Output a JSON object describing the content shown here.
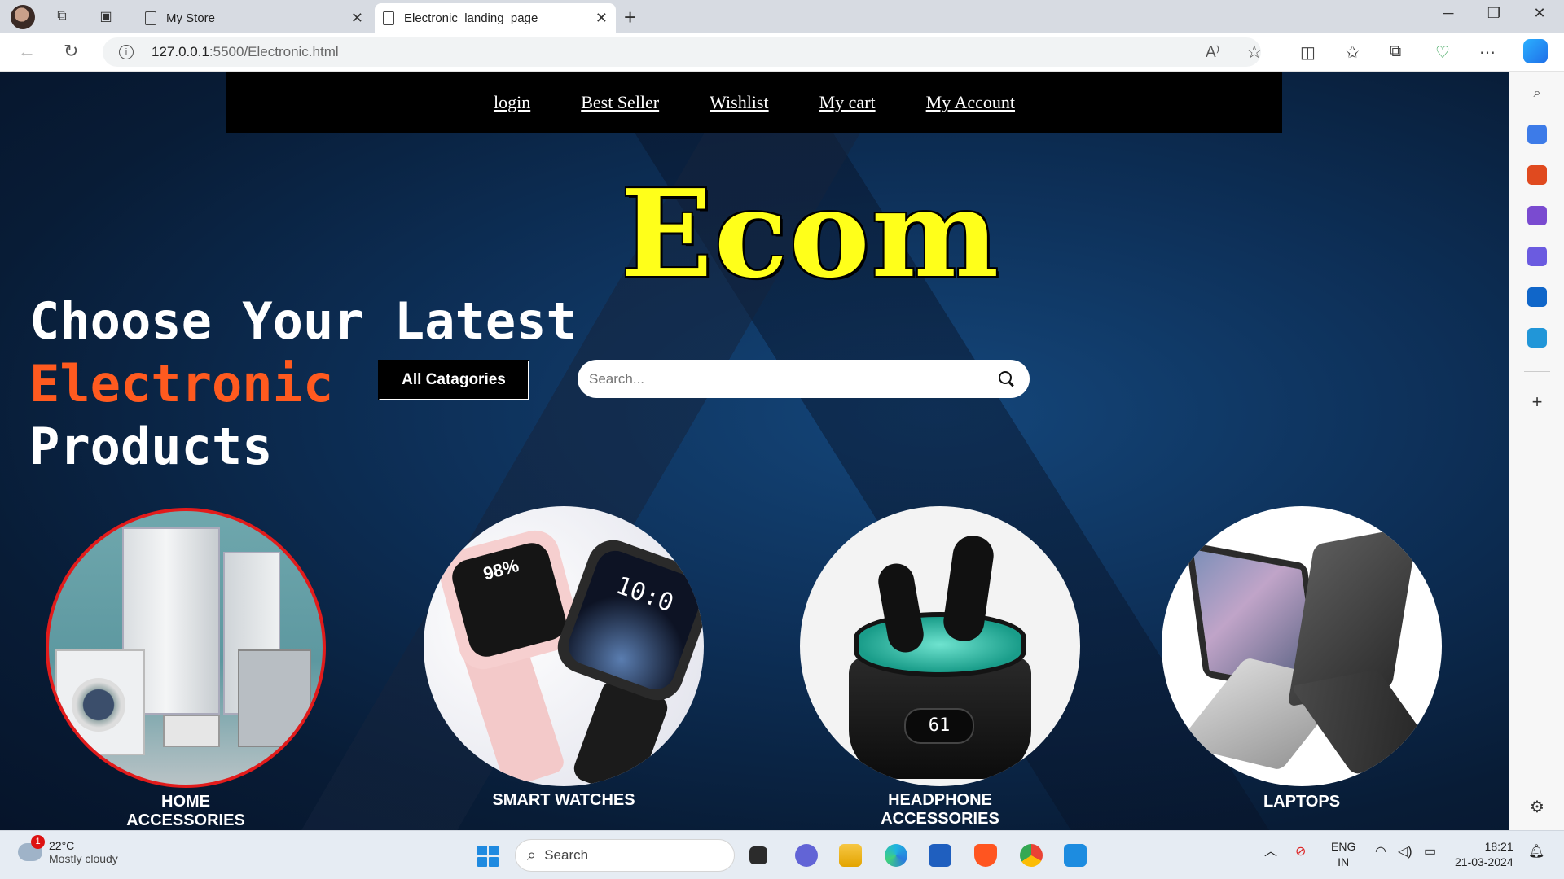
{
  "browser": {
    "tabs": [
      {
        "label": "My Store",
        "active": false
      },
      {
        "label": "Electronic_landing_page",
        "active": true
      }
    ],
    "url_host": "127.0.0.1",
    "url_path": ":5500/Electronic.html",
    "new_tab_symbol": "+",
    "window_controls": [
      "─",
      "❐",
      "✕"
    ]
  },
  "site": {
    "nav": [
      "login",
      "Best Seller",
      "Wishlist",
      "My cart",
      "My Account"
    ],
    "brand": "Ecom",
    "headline": {
      "line1": "Choose Your Latest",
      "accent": "Electronic",
      "line3": "Products"
    },
    "category_button": "All Catagories",
    "search_placeholder": "Search...",
    "categories": [
      {
        "label_line1": "HOME",
        "label_line2": "ACCESSORIES",
        "selected": true
      },
      {
        "label_line1": "SMART WATCHES",
        "label_line2": "",
        "selected": false
      },
      {
        "label_line1": "HEADPHONE",
        "label_line2": "ACCESSORIES",
        "selected": false
      },
      {
        "label_line1": "LAPTOPS",
        "label_line2": "",
        "selected": false
      }
    ],
    "colors": {
      "brand": "#ffff1a",
      "accent": "#ff5a1f",
      "selected_ring": "#e21b1b"
    },
    "watch_screen": {
      "percent": "98%",
      "time": "10:0"
    },
    "earbuds_display": "61"
  },
  "taskbar": {
    "weather_temp": "22°C",
    "weather_desc": "Mostly cloudy",
    "weather_badge": "1",
    "search_label": "Search",
    "lang_line1": "ENG",
    "lang_line2": "IN",
    "time": "18:21",
    "date": "21-03-2024"
  }
}
